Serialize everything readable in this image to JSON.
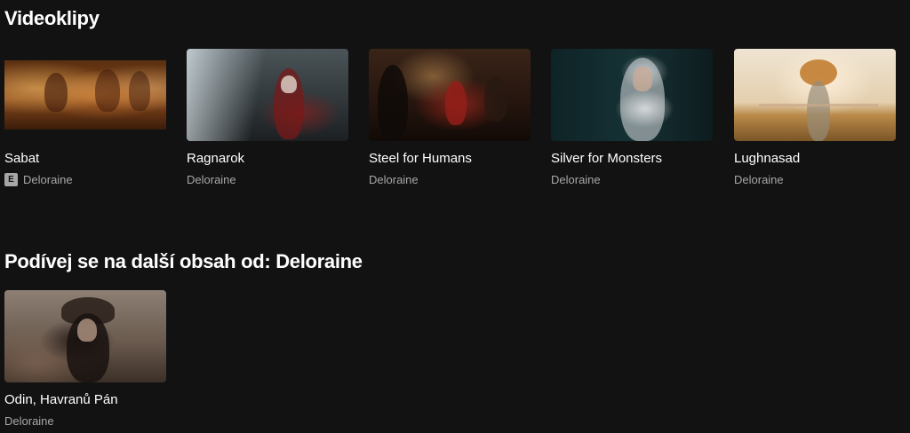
{
  "sections": [
    {
      "title": "Videoklipy",
      "cards": [
        {
          "title": "Sabat",
          "artist": "Deloraine",
          "explicit": true,
          "explicit_label": "E"
        },
        {
          "title": "Ragnarok",
          "artist": "Deloraine",
          "explicit": false
        },
        {
          "title": "Steel for Humans",
          "artist": "Deloraine",
          "explicit": false
        },
        {
          "title": "Silver for Monsters",
          "artist": "Deloraine",
          "explicit": false
        },
        {
          "title": "Lughnasad",
          "artist": "Deloraine",
          "explicit": false
        }
      ]
    },
    {
      "title": "Podívej se na další obsah od: Deloraine",
      "cards": [
        {
          "title": "Odin, Havranů Pán",
          "artist": "Deloraine",
          "explicit": false
        }
      ]
    }
  ],
  "colors": {
    "background": "#121212",
    "primary_text": "#ffffff",
    "secondary_text": "#a7a7a7"
  }
}
